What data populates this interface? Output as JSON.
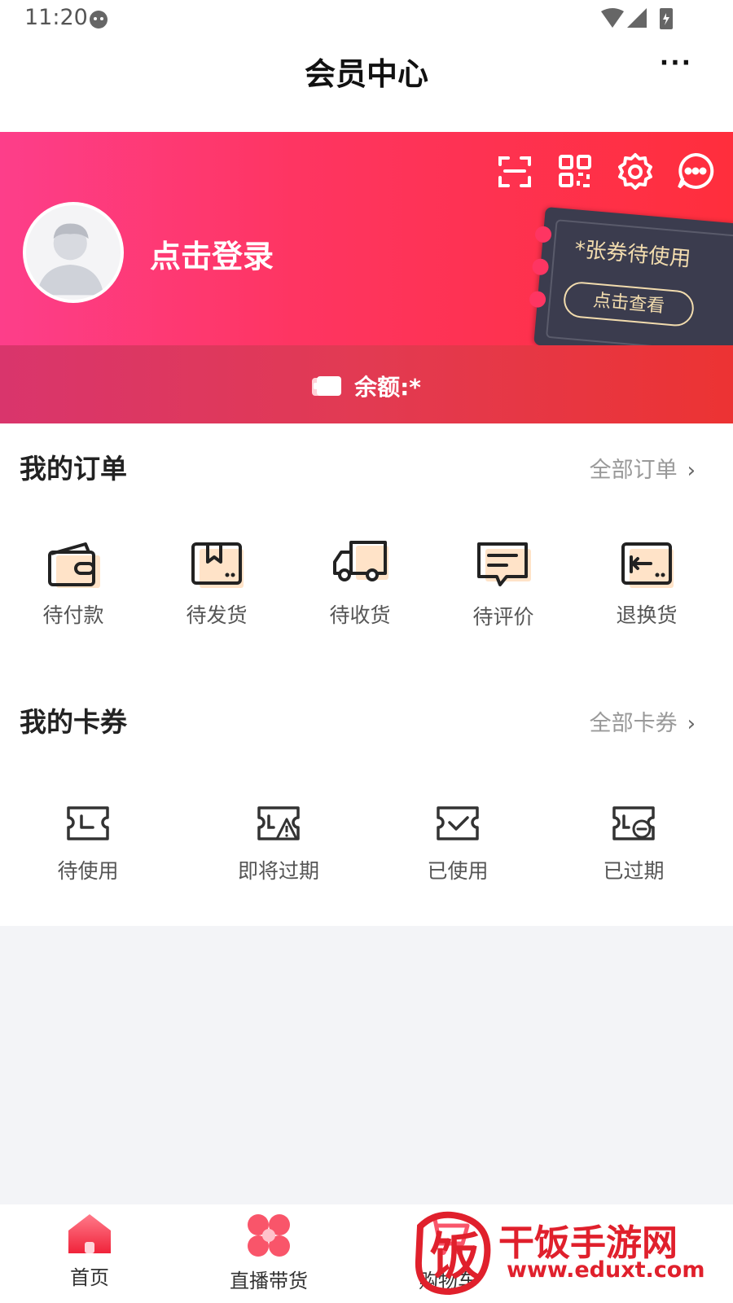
{
  "status_bar": {
    "time": "11:20"
  },
  "header": {
    "title": "会员中心",
    "more": "···"
  },
  "profile": {
    "login_text": "点击登录",
    "coupon_card": {
      "text": "*张券待使用",
      "button": "点击查看"
    },
    "balance_label": "余额:*"
  },
  "orders": {
    "title": "我的订单",
    "all_link": "全部订单",
    "items": [
      {
        "label": "待付款",
        "icon": "wallet-icon"
      },
      {
        "label": "待发货",
        "icon": "package-icon"
      },
      {
        "label": "待收货",
        "icon": "truck-icon"
      },
      {
        "label": "待评价",
        "icon": "comment-icon"
      },
      {
        "label": "退换货",
        "icon": "return-icon"
      }
    ]
  },
  "coupons": {
    "title": "我的卡券",
    "all_link": "全部卡券",
    "items": [
      {
        "label": "待使用",
        "icon": "ticket-clock-icon"
      },
      {
        "label": "即将过期",
        "icon": "ticket-warning-icon"
      },
      {
        "label": "已使用",
        "icon": "ticket-check-icon"
      },
      {
        "label": "已过期",
        "icon": "ticket-minus-icon"
      }
    ]
  },
  "tab_bar": {
    "items": [
      {
        "label": "首页",
        "icon": "home-icon"
      },
      {
        "label": "直播带货",
        "icon": "live-icon"
      },
      {
        "label": "购物车",
        "icon": "cart-icon"
      }
    ]
  },
  "watermark": {
    "name": "干饭手游网",
    "url": "www.eduxt.com",
    "mark": "饭"
  },
  "colors": {
    "accent": "#fe3562",
    "ticket_dark": "#3b3c4e",
    "gold": "#f2dcae",
    "icon_fill": "#ffe3c8"
  }
}
